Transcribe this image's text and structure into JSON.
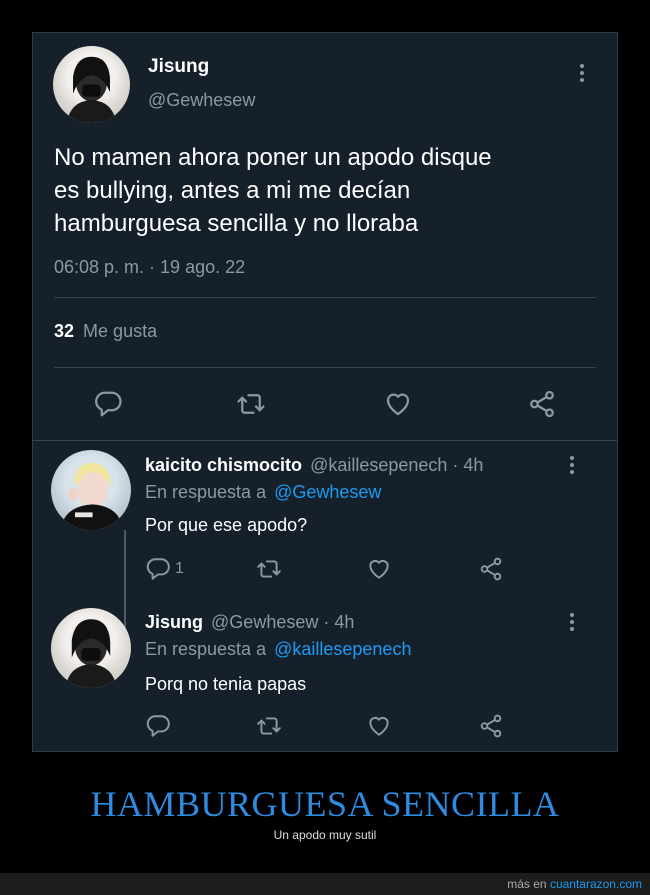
{
  "colors": {
    "card_bg": "#15202b",
    "muted": "#8b98a5",
    "link": "#1d9bf0",
    "title": "#2e8be0"
  },
  "main_tweet": {
    "name": "Jisung",
    "handle": "@Gewhesew",
    "text_lines": [
      "No mamen ahora poner un apodo disque",
      "es bullying, antes a mi me decían",
      "hamburguesa sencilla y no lloraba"
    ],
    "timestamp": "06:08 p. m. · 19 ago. 22",
    "likes_count": "32",
    "likes_label": "Me gusta"
  },
  "reply1": {
    "name": "kaicito chismocito",
    "meta": "@kaillesepenech · 4h",
    "in_reply_prefix": "En respuesta a",
    "in_reply_handle": "@Gewhesew",
    "text": "Por que ese apodo?",
    "reply_count": "1"
  },
  "reply2": {
    "name": "Jisung",
    "meta": "@Gewhesew · 4h",
    "in_reply_prefix": "En respuesta a",
    "in_reply_handle": "@kaillesepenech",
    "text": "Porq no tenia papas"
  },
  "icons": [
    "reply-icon",
    "retweet-icon",
    "like-icon",
    "share-icon",
    "more-icon"
  ],
  "footer": {
    "title": "HAMBURGUESA SENCILLA",
    "subtitle": "Un apodo muy sutil",
    "source_prefix": "más en",
    "source_link": "cuantarazon.com"
  }
}
